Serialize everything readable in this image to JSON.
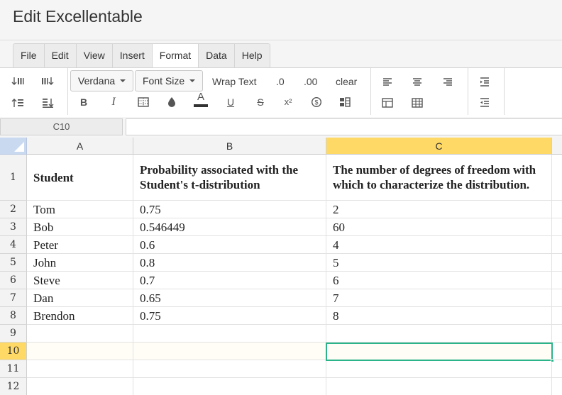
{
  "app": {
    "title": "Edit Excellentable"
  },
  "menu": {
    "tabs": [
      {
        "label": "File",
        "active": false
      },
      {
        "label": "Edit",
        "active": false
      },
      {
        "label": "View",
        "active": false
      },
      {
        "label": "Insert",
        "active": false
      },
      {
        "label": "Format",
        "active": true
      },
      {
        "label": "Data",
        "active": false
      },
      {
        "label": "Help",
        "active": false
      }
    ]
  },
  "toolbar": {
    "font_family": "Verdana",
    "font_size": "Font Size",
    "wrap_text": "Wrap Text",
    "decimal_one": ".0",
    "decimal_two": ".00",
    "clear": "clear",
    "bold": "B",
    "italic": "I",
    "font_color": "A",
    "underline": "U",
    "strikethrough": "S",
    "superscript": "x²",
    "font_color_bar": "#333333"
  },
  "formula_bar": {
    "cell_ref": "C10",
    "value": ""
  },
  "sheet": {
    "columns": [
      {
        "label": "A",
        "selected": false
      },
      {
        "label": "B",
        "selected": false
      },
      {
        "label": "C",
        "selected": true
      }
    ],
    "rows": [
      {
        "num": "1",
        "cells": [
          "Student",
          "Probability associated with the Student's t-distribution",
          "The number of degrees of freedom with which to characterize the distribution."
        ]
      },
      {
        "num": "2",
        "cells": [
          "Tom",
          "0.75",
          "2"
        ]
      },
      {
        "num": "3",
        "cells": [
          "Bob",
          "0.546449",
          "60"
        ]
      },
      {
        "num": "4",
        "cells": [
          "Peter",
          "0.6",
          "4"
        ]
      },
      {
        "num": "5",
        "cells": [
          "John",
          "0.8",
          "5"
        ]
      },
      {
        "num": "6",
        "cells": [
          "Steve",
          "0.7",
          "6"
        ]
      },
      {
        "num": "7",
        "cells": [
          "Dan",
          "0.65",
          "7"
        ]
      },
      {
        "num": "8",
        "cells": [
          "Brendon",
          "0.75",
          "8"
        ]
      },
      {
        "num": "9",
        "cells": [
          "",
          "",
          ""
        ]
      },
      {
        "num": "10",
        "cells": [
          "",
          "",
          ""
        ]
      },
      {
        "num": "11",
        "cells": [
          "",
          "",
          ""
        ]
      },
      {
        "num": "12",
        "cells": [
          "",
          "",
          ""
        ]
      }
    ],
    "selected_cell": "C10",
    "selection_color": "#2bb38a",
    "header_highlight_color": "#ffd966"
  }
}
